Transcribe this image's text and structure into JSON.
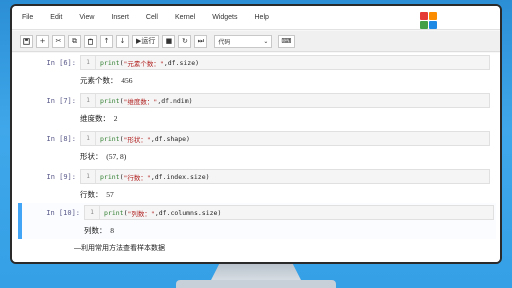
{
  "menubar": {
    "items": [
      "File",
      "Edit",
      "View",
      "Insert",
      "Cell",
      "Kernel",
      "Widgets",
      "Help"
    ]
  },
  "toolbar": {
    "run_label": "运行",
    "cell_type": "代码",
    "select_arrow": "⌄"
  },
  "cells": [
    {
      "prompt": "In  [6]:",
      "line": "1",
      "fn": "print",
      "open": "(",
      "str": "\"元素个数：\"",
      "rest": ",df.size)",
      "output": "元素个数：  456"
    },
    {
      "prompt": "In  [7]:",
      "line": "1",
      "fn": "print",
      "open": "(",
      "str": "\"维度数：\"",
      "rest": ",df.ndim)",
      "output": "维度数：  2"
    },
    {
      "prompt": "In  [8]:",
      "line": "1",
      "fn": "print",
      "open": "(",
      "str": "\"形状：\"",
      "rest": ",df.shape)",
      "output": "形状：  (57, 8)"
    },
    {
      "prompt": "In  [9]:",
      "line": "1",
      "fn": "print",
      "open": "(",
      "str": "\"行数：\"",
      "rest": ",df.index.size)",
      "output": "行数：  57"
    },
    {
      "prompt": "In  [10]:",
      "line": "1",
      "fn": "print",
      "open": "(",
      "str": "\"列数：\"",
      "rest": ",df.columns.size)",
      "output": "列数：  8"
    }
  ],
  "markdown": {
    "text": "—利用常用方法查看样本数据"
  },
  "colors": {
    "accent": "#42a5f5",
    "background": "#2c8fd6"
  }
}
